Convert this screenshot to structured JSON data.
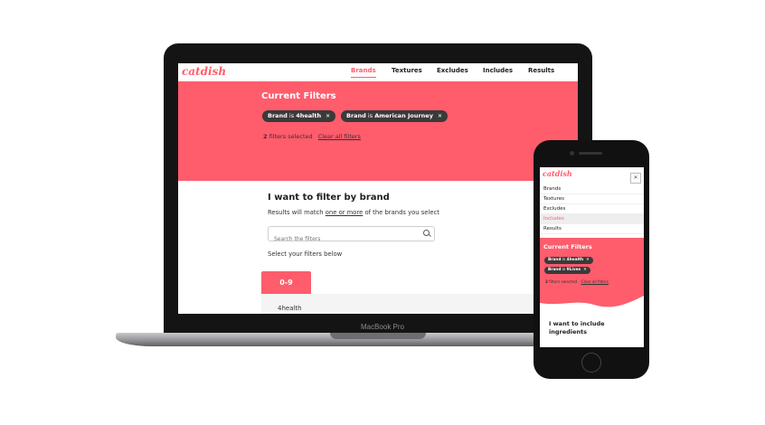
{
  "laptop": {
    "logo": "catdish",
    "device_label": "MacBook Pro",
    "nav": [
      "Brands",
      "Textures",
      "Excludes",
      "Includes",
      "Results"
    ],
    "current_filters": {
      "title": "Current Filters",
      "chips": [
        {
          "field": "Brand",
          "op": "is",
          "value": "4health"
        },
        {
          "field": "Brand",
          "op": "is",
          "value": "American Journey"
        }
      ],
      "count": "2",
      "count_text": "filters selected",
      "clear_label": "Clear all filters"
    },
    "section": {
      "title": "I want to filter by brand",
      "subtitle_pre": "Results will match",
      "subtitle_link": "one or more",
      "subtitle_post": "of the brands you select",
      "search_placeholder": "Search the filters",
      "select_label": "Select your filters below",
      "tab": "0-9",
      "first_item": "4health"
    }
  },
  "phone": {
    "logo": "catdish",
    "close": "✕",
    "menu": [
      "Brands",
      "Textures",
      "Excludes",
      "Includes",
      "Results"
    ],
    "current_filters": {
      "title": "Current Filters",
      "chips": [
        {
          "field": "Brand",
          "op": "is",
          "value": "4health"
        },
        {
          "field": "Brand",
          "op": "is",
          "value": "9Lives"
        }
      ],
      "count": "2",
      "count_text": "filters selected",
      "clear_label": "Clear all filters"
    },
    "section_title": "I want to include ingredients"
  },
  "colors": {
    "accent": "#ff5c6c",
    "chip": "#3a3a3a"
  }
}
